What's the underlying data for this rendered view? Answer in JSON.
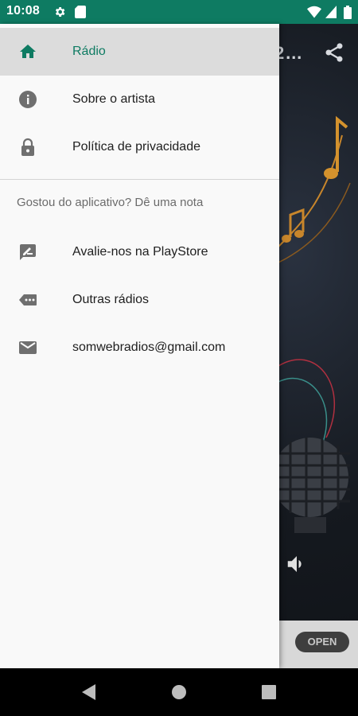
{
  "status_bar": {
    "time": "10:08",
    "icons": [
      "gear-icon",
      "sd-card-icon",
      "wifi-icon",
      "signal-icon",
      "battery-icon"
    ],
    "background_color": "#0e7b62"
  },
  "background_app": {
    "toolbar_fragment": "2…",
    "ad_open_label": "OPEN"
  },
  "drawer": {
    "accent_color": "#0e7b62",
    "items": [
      {
        "label": "Rádio",
        "icon": "home-icon",
        "selected": true
      },
      {
        "label": "Sobre o artista",
        "icon": "info-icon",
        "selected": false
      },
      {
        "label": "Política de privacidade",
        "icon": "lock-icon",
        "selected": false
      }
    ],
    "subheader": "Gostou do aplicativo? Dê uma nota",
    "secondary_items": [
      {
        "label": "Avalie-nos na PlayStore",
        "icon": "rate-review-icon"
      },
      {
        "label": "Outras rádios",
        "icon": "label-more-icon"
      },
      {
        "label": "somwebradios@gmail.com",
        "icon": "email-icon"
      }
    ]
  },
  "nav_bar": {
    "buttons": [
      "back-icon",
      "home-circle-icon",
      "recents-icon"
    ]
  }
}
